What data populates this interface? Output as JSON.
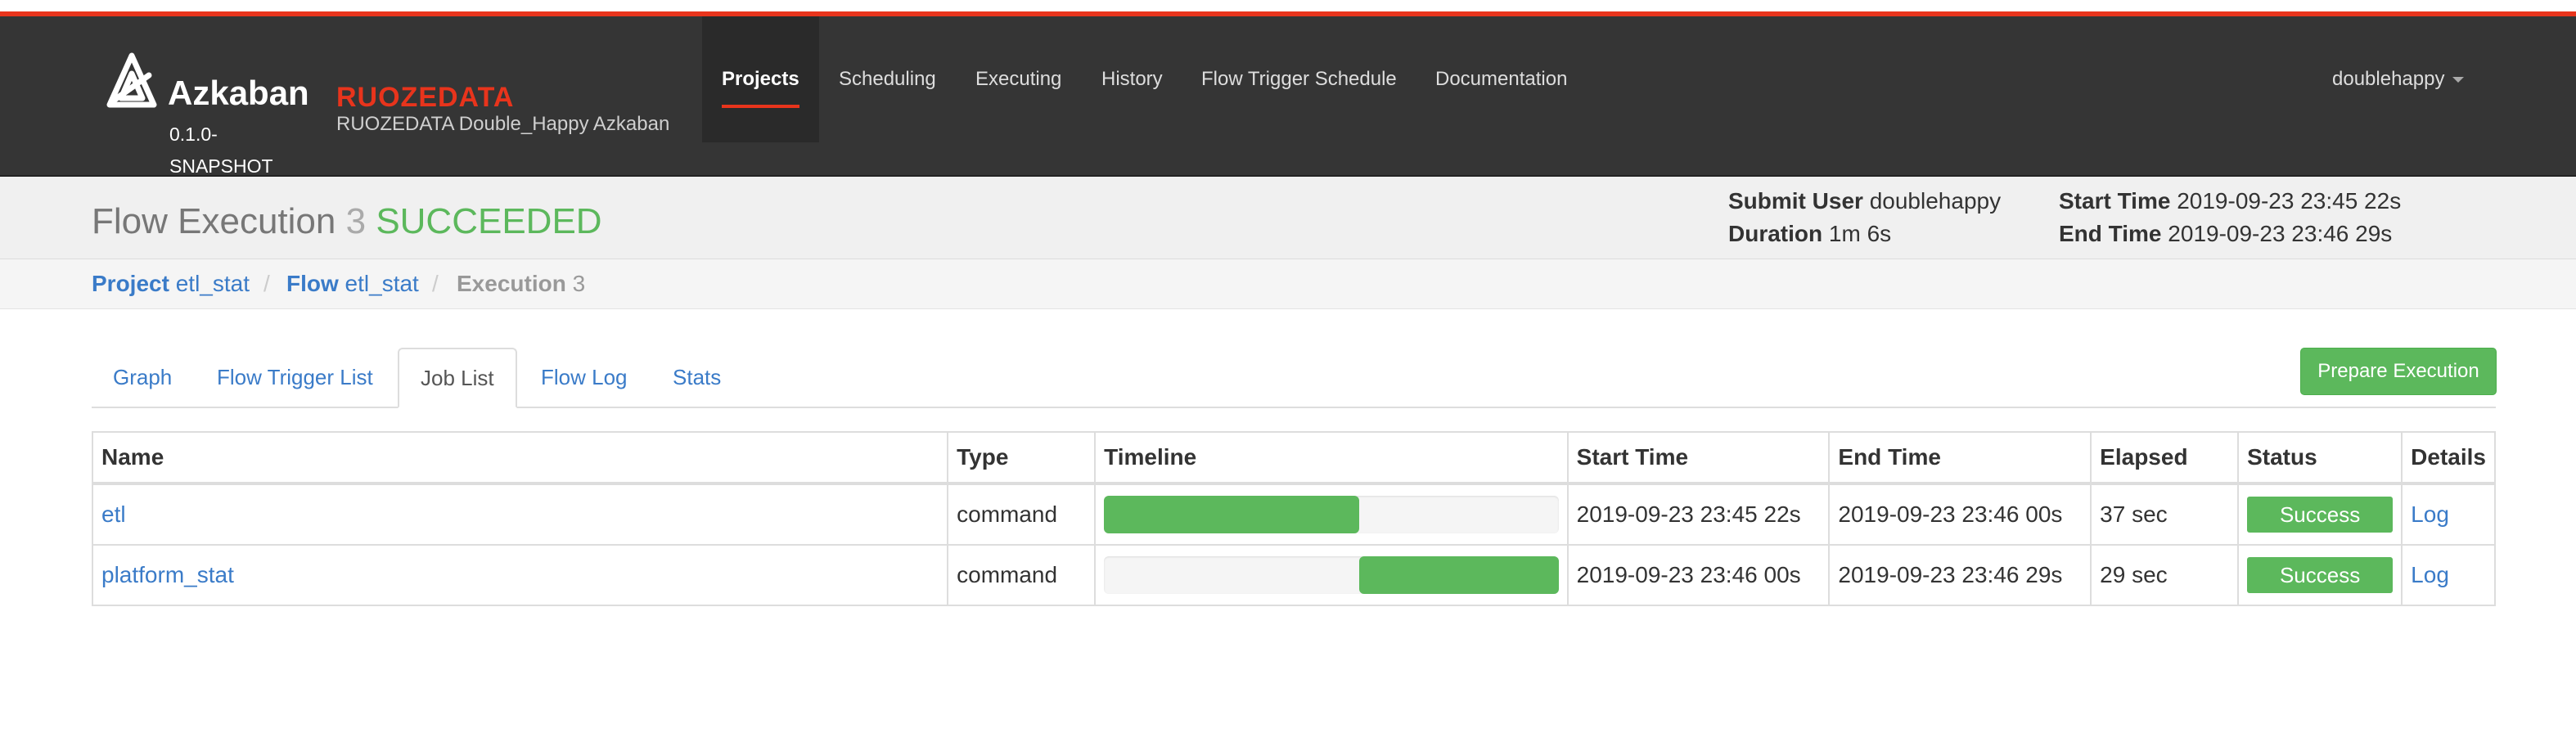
{
  "brand": {
    "name": "Azkaban",
    "version": "0.1.0-SNAPSHOT",
    "company": "RUOZEDATA",
    "subtitle": "RUOZEDATA Double_Happy Azkaban"
  },
  "nav": {
    "items": [
      {
        "label": "Projects",
        "active": true
      },
      {
        "label": "Scheduling"
      },
      {
        "label": "Executing"
      },
      {
        "label": "History"
      },
      {
        "label": "Flow Trigger Schedule"
      },
      {
        "label": "Documentation"
      }
    ],
    "user": "doublehappy"
  },
  "header": {
    "title": "Flow Execution",
    "exec_id": "3",
    "status": "SUCCEEDED",
    "submit_user_label": "Submit User",
    "submit_user": "doublehappy",
    "duration_label": "Duration",
    "duration": "1m 6s",
    "start_label": "Start Time",
    "start": "2019-09-23 23:45 22s",
    "end_label": "End Time",
    "end": "2019-09-23 23:46 29s"
  },
  "breadcrumb": {
    "project_label": "Project",
    "project": "etl_stat",
    "flow_label": "Flow",
    "flow": "etl_stat",
    "exec_label": "Execution",
    "exec": "3",
    "separator": "/"
  },
  "tabs": [
    {
      "label": "Graph"
    },
    {
      "label": "Flow Trigger List"
    },
    {
      "label": "Job List",
      "active": true
    },
    {
      "label": "Flow Log"
    },
    {
      "label": "Stats"
    }
  ],
  "prepare_button": "Prepare Execution",
  "table": {
    "headers": [
      "Name",
      "Type",
      "Timeline",
      "Start Time",
      "End Time",
      "Elapsed",
      "Status",
      "Details"
    ],
    "rows": [
      {
        "name": "etl",
        "type": "command",
        "timeline_start": 0.0,
        "timeline_end": 0.561,
        "start": "2019-09-23 23:45 22s",
        "end": "2019-09-23 23:46 00s",
        "elapsed": "37 sec",
        "status": "Success",
        "details": "Log"
      },
      {
        "name": "platform_stat",
        "type": "command",
        "timeline_start": 0.561,
        "timeline_end": 1.0,
        "start": "2019-09-23 23:46 00s",
        "end": "2019-09-23 23:46 29s",
        "elapsed": "29 sec",
        "status": "Success",
        "details": "Log"
      }
    ]
  },
  "colors": {
    "accent_red": "#e8341c",
    "success_green": "#5cb85c",
    "link_blue": "#3a7bc8",
    "navbar_bg": "#353535"
  }
}
